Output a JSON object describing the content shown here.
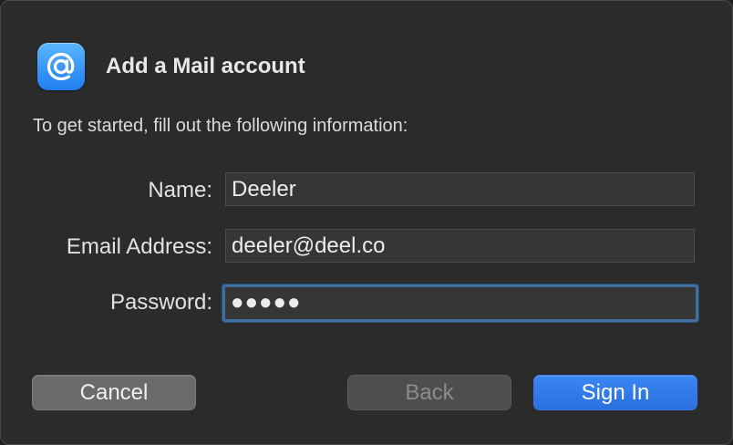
{
  "dialog": {
    "title": "Add a Mail account",
    "intro": "To get started, fill out the following information:",
    "app_icon": "at-sign-icon"
  },
  "form": {
    "name_label": "Name:",
    "name_value": "Deeler",
    "email_label": "Email Address:",
    "email_value": "deeler@deel.co",
    "password_label": "Password:",
    "password_masked": "●●●●●"
  },
  "buttons": {
    "cancel": "Cancel",
    "back": "Back",
    "sign_in": "Sign In"
  },
  "colors": {
    "dialog_background": "#2b2b2b",
    "accent": "#2a6fe0",
    "focus_ring": "#3f6f9e",
    "icon_blue": "#1f7ef0"
  }
}
